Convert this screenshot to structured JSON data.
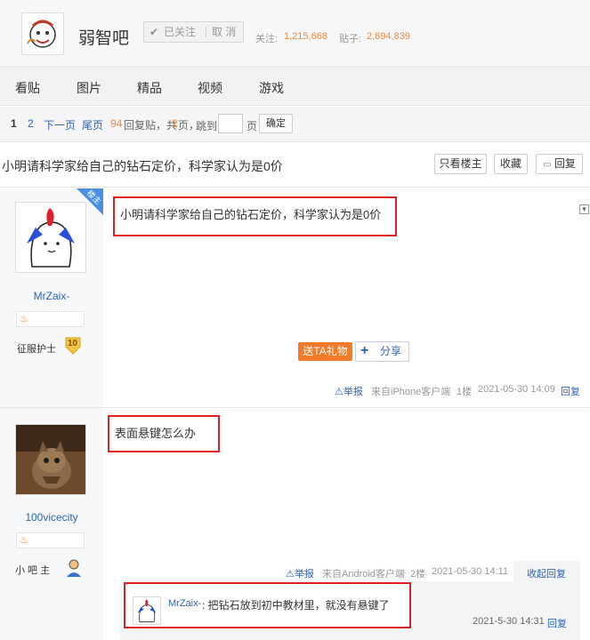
{
  "header": {
    "forum_name": "弱智吧",
    "follow_label": "已关注",
    "cancel_label": "取 消",
    "follow_stat_label": "关注:",
    "follow_stat_value": "1,215,668",
    "posts_stat_label": "贴子:",
    "posts_stat_value": "2,894,839"
  },
  "tabs": [
    "看贴",
    "图片",
    "精品",
    "视频",
    "游戏"
  ],
  "pager": {
    "current": "1",
    "page2": "2",
    "next": "下一页",
    "last": "尾页",
    "reply_count": "94",
    "reply_text": "回复贴，共",
    "total_pages": "2",
    "pages_suffix": "页，",
    "jump_label": "跳到",
    "page_unit": "页",
    "confirm": "确定"
  },
  "thread": {
    "title": "小明请科学家给自己的钻石定价，科学家认为是0价",
    "only_op": "只看楼主",
    "favorite": "收藏",
    "reply": "回复"
  },
  "posts": [
    {
      "author": "MrZaix-",
      "badge": "楼主",
      "title_label": "征服护士",
      "level": "10",
      "content": "小明请科学家给自己的钻石定价，科学家认为是0价",
      "gift": "送TA礼物",
      "share": "分享",
      "report": "举报",
      "source": "来自iPhone客户端",
      "floor": "1楼",
      "time": "2021-05-30 14:09",
      "reply": "回复"
    },
    {
      "author": "100vicecity",
      "title_label": "小 吧 主",
      "content": "表面悬键怎么办",
      "report": "举报",
      "source": "来自Android客户端",
      "floor": "2楼",
      "time": "2021-05-30 14:11",
      "collapse": "收起回复",
      "sub_reply": {
        "author": "MrZaix-",
        "text": ": 把钻石放到初中教材里，就没有悬键了",
        "time": "2021-5-30 14:31",
        "reply": "回复"
      }
    }
  ],
  "colors": {
    "link": "#2d64b3",
    "accent": "#f08a3e",
    "highlight_border": "#e02020",
    "gift": "#f27b2b"
  }
}
